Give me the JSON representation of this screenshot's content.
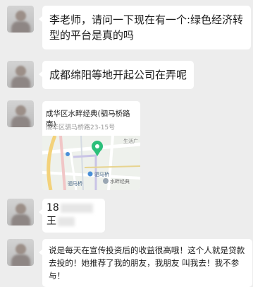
{
  "messages": {
    "m1": {
      "text": "李老师，请问一下现在有一个:绿色经济转型的平台是真的吗"
    },
    "m2": {
      "text": "成都绵阳等地开起公司在弄呢"
    },
    "m3": {
      "location_title": "成华区水畔经典(驷马桥路南)",
      "location_address": "成华区驷马桥路23-15号",
      "map_labels": {
        "station": "驷马桥",
        "station_left": "驷马桥",
        "poi": "水畔经典",
        "area": "生活广"
      }
    },
    "m4": {
      "line1_prefix": "18",
      "line2_prefix": "王"
    },
    "m5": {
      "text": "说是每天在宣传投资后的收益很高哦！这个人就是贷款去投的！她推荐了我的朋友，我朋友 叫我去！我不参与！"
    }
  },
  "colors": {
    "background": "#ededed",
    "bubble": "#ffffff",
    "map_pin": "#2bbf7a",
    "metro_blue": "#4a8fd8"
  }
}
